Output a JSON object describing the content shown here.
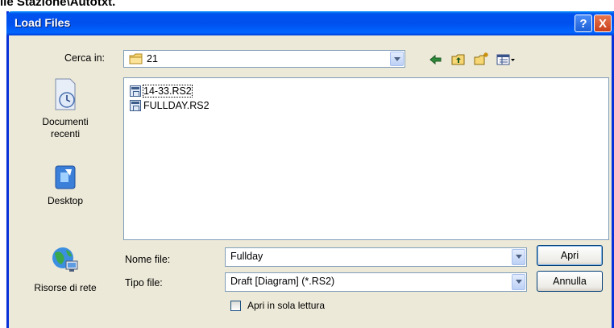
{
  "doc_heading": "ile Stazione\\Autotxt.",
  "dialog": {
    "title": "Load Files",
    "help_label": "?",
    "close_label": "X"
  },
  "look_in": {
    "label": "Cerca in:",
    "value": "21"
  },
  "toolbar": {
    "icons": [
      "back-arrow-icon",
      "up-one-level-icon",
      "new-folder-icon",
      "view-menu-icon"
    ]
  },
  "places": [
    {
      "label": "Documenti recenti",
      "icon": "recent-documents-icon"
    },
    {
      "label": "Desktop",
      "icon": "desktop-icon"
    },
    {
      "label": "Risorse di rete",
      "icon": "network-places-icon"
    }
  ],
  "files": [
    {
      "name": "14-33.RS2",
      "icon": "rs2-file-icon"
    },
    {
      "name": "FULLDAY.RS2",
      "icon": "rs2-file-icon"
    }
  ],
  "file_name": {
    "label": "Nome file:",
    "value": "Fullday"
  },
  "file_type": {
    "label": "Tipo file:",
    "value": "Draft [Diagram]  (*.RS2)"
  },
  "buttons": {
    "open": "Apri",
    "cancel": "Annulla"
  },
  "read_only": {
    "label": "Apri in sola lettura",
    "checked": false
  },
  "colors": {
    "titlebar": "#0054e3",
    "dialog_bg": "#ece9d8",
    "border": "#7f9db9"
  }
}
